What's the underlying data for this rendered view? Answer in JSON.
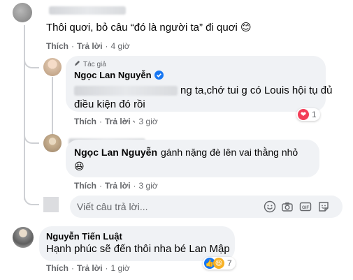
{
  "comments": {
    "top": {
      "text": "Thôi quơi, bỏ câu “đó là người ta” đi quơi 😊",
      "actions": {
        "like": "Thích",
        "reply": "Trả lời",
        "time": "4 giờ"
      }
    },
    "author_reply": {
      "badge": "Tác giả",
      "name": "Ngọc Lan Nguyễn",
      "line1": "ng ta,chớ tui g có Louis hội tụ đủ",
      "line2": "điều kiện đó rồi",
      "reaction_count": "1",
      "actions": {
        "like": "Thích",
        "reply": "Trả lời",
        "time": "3 giờ"
      }
    },
    "second_reply": {
      "name": "Ngọc Lan Nguyễn",
      "text": "gánh nặng đè lên vai thằng nhỏ",
      "emoji": "😆",
      "actions": {
        "like": "Thích",
        "reply": "Trả lời",
        "time": "3 giờ"
      }
    },
    "reply_input": {
      "placeholder": "Viết câu trả lời..."
    },
    "bottom": {
      "name": "Nguyễn Tiến Luật",
      "text": "Hạnh phúc sẽ đến thôi nha bé Lan Mập",
      "reaction_count": "7",
      "actions": {
        "like": "Thích",
        "reply": "Trả lời",
        "time": "1 giờ"
      }
    }
  },
  "colors": {
    "bubble": "#f0f2f5",
    "meta": "#65676b",
    "verified": "#1877f2",
    "love": "#f33e58",
    "like": "#1877f2",
    "haha": "#f7b125"
  },
  "icons": [
    "pencil-icon",
    "verified-badge-icon",
    "heart-icon",
    "like-icon",
    "haha-icon",
    "emoji-icon",
    "camera-icon",
    "gif-icon",
    "sticker-icon",
    "more-icon"
  ]
}
